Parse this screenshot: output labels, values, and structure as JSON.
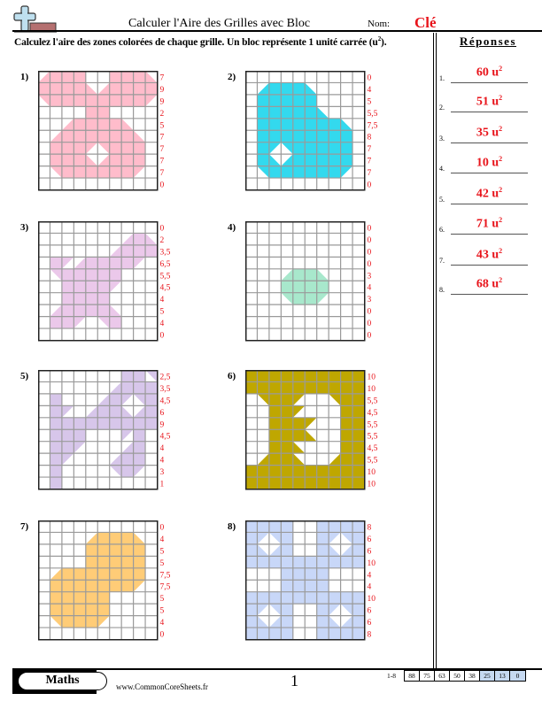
{
  "header": {
    "logo_icon": "plus-with-block-icon",
    "title": "Calculer l'Aire des Grilles avec Bloc",
    "name_label": "Nom:",
    "name_value": "Clé",
    "instructions": "Calculez l'aire des zones colorées de chaque grille. Un bloc représente 1 unité carrée (u",
    "instructions_sup": "2",
    "instructions_end": ")."
  },
  "answers": {
    "title": "Réponses",
    "unit": "u",
    "unit_sup": "2",
    "items": [
      {
        "num": "1.",
        "value": "60"
      },
      {
        "num": "2.",
        "value": "51"
      },
      {
        "num": "3.",
        "value": "35"
      },
      {
        "num": "4.",
        "value": "10"
      },
      {
        "num": "5.",
        "value": "42"
      },
      {
        "num": "6.",
        "value": "71"
      },
      {
        "num": "7.",
        "value": "43"
      },
      {
        "num": "8.",
        "value": "68"
      }
    ]
  },
  "problems": [
    {
      "label": "1)",
      "color": "#ffbccb",
      "row_counts": [
        "7",
        "9",
        "9",
        "2",
        "5",
        "7",
        "7",
        "7",
        "7",
        "0"
      ],
      "cells": [
        "BR F F F . . F F F BL",
        "F F F F BL BR F F F F",
        "TR F F F F F F F F TL",
        ". . . . F F . . . .",
        ". . BR F F F F BL . .",
        ". BR F F F F F F BL .",
        ". F F F TL TR F F F .",
        ". F F F BL BR F F F .",
        ". TR F F F F F F TL .",
        ". . . . . . . . . ."
      ]
    },
    {
      "label": "2)",
      "color": "#33d9ee",
      "row_counts": [
        "0",
        "4",
        "5",
        "5,5",
        "7,5",
        "8",
        "7",
        "7",
        "7",
        "0"
      ],
      "cells": [
        ". . . . . . . . . .",
        ". BR F F F BL . . . .",
        ". F F F F F . . . .",
        ". F F F F F BL . . .",
        ". F F F F F F F BL .",
        ". F F F F F F F F .",
        ". F TL TR F F F F F .",
        ". F BL BR F F F F F .",
        ". TR F F F F F F TL .",
        ". . . . . . . . . ."
      ]
    },
    {
      "label": "3)",
      "color": "#ebc8ea",
      "row_counts": [
        "0",
        "2",
        "3,5",
        "6,5",
        "5,5",
        "4,5",
        "4",
        "5",
        "4",
        "0"
      ],
      "cells": [
        ". . . . . . . . . .",
        ". . . . . . . BR F BL",
        ". . . . . . BR F F F",
        ". F TL BR F F F F TL .",
        ". TR F F F F F . . .",
        ". . F F F F TL . . .",
        ". . F F F F . . . .",
        ". BR F F F F BL . . .",
        ". F F TL . TR F . . .",
        ". . . . . . . . . ."
      ]
    },
    {
      "label": "4)",
      "color": "#a8e8cc",
      "row_counts": [
        "0",
        "0",
        "0",
        "0",
        "3",
        "4",
        "3",
        "0",
        "0",
        "0"
      ],
      "cells": [
        ". . . . . . . . . .",
        ". . . . . . . . . .",
        ". . . . . . . . . .",
        ". . . . . . . . . .",
        ". . . BR F F BL . . .",
        ". . . F F F F . . .",
        ". . . TR F F TL . . .",
        ". . . . . . . . . .",
        ". . . . . . . . . .",
        ". . . . . . . . . ."
      ]
    },
    {
      "label": "5)",
      "color": "#d7c6ea",
      "row_counts": [
        "2,5",
        "3,5",
        "4,5",
        "6",
        "9",
        "4,5",
        "4",
        "4",
        "3",
        "1"
      ],
      "cells": [
        ". . . . . . . F F TR",
        ". . . . . . BR F F F",
        ". F . . . BR F TL TR F",
        ". F TL . BR F F BL BR F",
        ". F F F F F F F F F",
        ". F F F . . . TL F .",
        ". F F TL . . . BR F .",
        ". F TL . . . BR F F .",
        ". F . . . . TR F TL .",
        ". F . . . . . . . ."
      ]
    },
    {
      "label": "6)",
      "color": "#bfa700",
      "row_counts": [
        "10",
        "10",
        "5,5",
        "4,5",
        "5,5",
        "5,5",
        "4,5",
        "5,5",
        "10",
        "10"
      ],
      "cells": [
        "F F F F F F F F F F",
        "F F F F F F F F F F",
        ". TR F F TL . . TR F F",
        ". . F F TL . . . F F",
        ". . F F F TL . . F F",
        ". . F F F BL . . F F",
        ". . F F BL . . . F F",
        ". BR F F BL . . BR F F",
        "F F F F F F F F F F",
        "F F F F F F F F F F"
      ]
    },
    {
      "label": "7)",
      "color": "#ffcc77",
      "row_counts": [
        "0",
        "4",
        "5",
        "5",
        "7,5",
        "7,5",
        "5",
        "5",
        "4",
        "0"
      ],
      "cells": [
        ". . . . . . . . . .",
        ". . . . BR F F F BL .",
        ". . . . F F F F F .",
        ". . . . F F F F F .",
        ". BR F F F F F F F .",
        ". F F F F F F F TL .",
        ". F F F F F . . . .",
        ". F F F F F . . . .",
        ". TR F F F TL . . . .",
        ". . . . . . . . . ."
      ]
    },
    {
      "label": "8)",
      "color": "#c8d7f8",
      "row_counts": [
        "8",
        "6",
        "6",
        "10",
        "4",
        "4",
        "10",
        "6",
        "6",
        "8"
      ],
      "cells": [
        "F F F F . . F F F F",
        "F TL TR F . . F TL TR F",
        "F BL BR F . . F BL BR F",
        "F F F F F F F F F F",
        ". . . F F F F . . .",
        ". . . F F F F . . .",
        "F F F F F F F F F F",
        "F TL TR F . . F TL TR F",
        "F BL BR F . . F BL BR F",
        "F F F F . . F F F F"
      ]
    }
  ],
  "footer": {
    "subject": "Maths",
    "website": "www.CommonCoreSheets.fr",
    "page_number": "1",
    "score_range": "1-8",
    "scores": [
      {
        "value": "88",
        "highlight": false
      },
      {
        "value": "75",
        "highlight": false
      },
      {
        "value": "63",
        "highlight": false
      },
      {
        "value": "50",
        "highlight": false
      },
      {
        "value": "38",
        "highlight": false
      },
      {
        "value": "25",
        "highlight": true
      },
      {
        "value": "13",
        "highlight": true
      },
      {
        "value": "0",
        "highlight": true
      }
    ]
  }
}
